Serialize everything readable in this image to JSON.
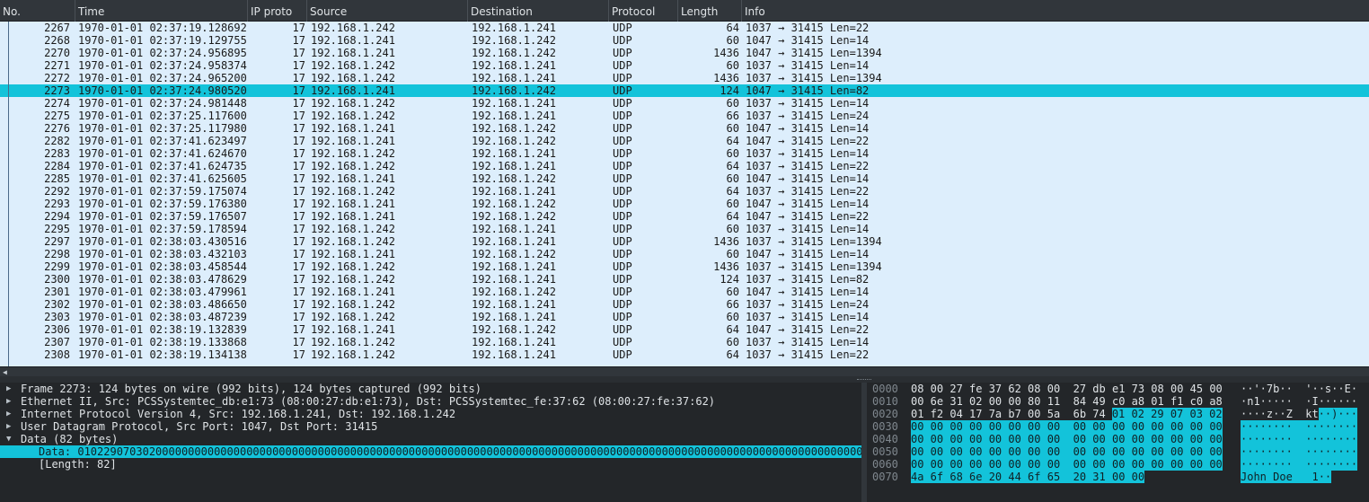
{
  "columns": [
    {
      "key": "no",
      "label": "No."
    },
    {
      "key": "time",
      "label": "Time"
    },
    {
      "key": "ip_proto",
      "label": "IP proto"
    },
    {
      "key": "source",
      "label": "Source"
    },
    {
      "key": "destination",
      "label": "Destination"
    },
    {
      "key": "protocol",
      "label": "Protocol"
    },
    {
      "key": "length",
      "label": "Length"
    },
    {
      "key": "info",
      "label": "Info"
    }
  ],
  "packets": [
    {
      "no": "2267",
      "time": "1970-01-01 02:37:19.128692",
      "ip_proto": "17",
      "source": "192.168.1.242",
      "destination": "192.168.1.241",
      "protocol": "UDP",
      "length": "64",
      "info": "1037 → 31415 Len=22"
    },
    {
      "no": "2268",
      "time": "1970-01-01 02:37:19.129755",
      "ip_proto": "17",
      "source": "192.168.1.241",
      "destination": "192.168.1.242",
      "protocol": "UDP",
      "length": "60",
      "info": "1047 → 31415 Len=14"
    },
    {
      "no": "2270",
      "time": "1970-01-01 02:37:24.956895",
      "ip_proto": "17",
      "source": "192.168.1.241",
      "destination": "192.168.1.242",
      "protocol": "UDP",
      "length": "1436",
      "info": "1047 → 31415 Len=1394"
    },
    {
      "no": "2271",
      "time": "1970-01-01 02:37:24.958374",
      "ip_proto": "17",
      "source": "192.168.1.242",
      "destination": "192.168.1.241",
      "protocol": "UDP",
      "length": "60",
      "info": "1037 → 31415 Len=14"
    },
    {
      "no": "2272",
      "time": "1970-01-01 02:37:24.965200",
      "ip_proto": "17",
      "source": "192.168.1.242",
      "destination": "192.168.1.241",
      "protocol": "UDP",
      "length": "1436",
      "info": "1037 → 31415 Len=1394"
    },
    {
      "no": "2273",
      "time": "1970-01-01 02:37:24.980520",
      "ip_proto": "17",
      "source": "192.168.1.241",
      "destination": "192.168.1.242",
      "protocol": "UDP",
      "length": "124",
      "info": "1047 → 31415 Len=82",
      "selected": true
    },
    {
      "no": "2274",
      "time": "1970-01-01 02:37:24.981448",
      "ip_proto": "17",
      "source": "192.168.1.242",
      "destination": "192.168.1.241",
      "protocol": "UDP",
      "length": "60",
      "info": "1037 → 31415 Len=14"
    },
    {
      "no": "2275",
      "time": "1970-01-01 02:37:25.117600",
      "ip_proto": "17",
      "source": "192.168.1.242",
      "destination": "192.168.1.241",
      "protocol": "UDP",
      "length": "66",
      "info": "1037 → 31415 Len=24"
    },
    {
      "no": "2276",
      "time": "1970-01-01 02:37:25.117980",
      "ip_proto": "17",
      "source": "192.168.1.241",
      "destination": "192.168.1.242",
      "protocol": "UDP",
      "length": "60",
      "info": "1047 → 31415 Len=14"
    },
    {
      "no": "2282",
      "time": "1970-01-01 02:37:41.623497",
      "ip_proto": "17",
      "source": "192.168.1.241",
      "destination": "192.168.1.242",
      "protocol": "UDP",
      "length": "64",
      "info": "1047 → 31415 Len=22"
    },
    {
      "no": "2283",
      "time": "1970-01-01 02:37:41.624670",
      "ip_proto": "17",
      "source": "192.168.1.242",
      "destination": "192.168.1.241",
      "protocol": "UDP",
      "length": "60",
      "info": "1037 → 31415 Len=14"
    },
    {
      "no": "2284",
      "time": "1970-01-01 02:37:41.624735",
      "ip_proto": "17",
      "source": "192.168.1.242",
      "destination": "192.168.1.241",
      "protocol": "UDP",
      "length": "64",
      "info": "1037 → 31415 Len=22"
    },
    {
      "no": "2285",
      "time": "1970-01-01 02:37:41.625605",
      "ip_proto": "17",
      "source": "192.168.1.241",
      "destination": "192.168.1.242",
      "protocol": "UDP",
      "length": "60",
      "info": "1047 → 31415 Len=14"
    },
    {
      "no": "2292",
      "time": "1970-01-01 02:37:59.175074",
      "ip_proto": "17",
      "source": "192.168.1.242",
      "destination": "192.168.1.241",
      "protocol": "UDP",
      "length": "64",
      "info": "1037 → 31415 Len=22"
    },
    {
      "no": "2293",
      "time": "1970-01-01 02:37:59.176380",
      "ip_proto": "17",
      "source": "192.168.1.241",
      "destination": "192.168.1.242",
      "protocol": "UDP",
      "length": "60",
      "info": "1047 → 31415 Len=14"
    },
    {
      "no": "2294",
      "time": "1970-01-01 02:37:59.176507",
      "ip_proto": "17",
      "source": "192.168.1.241",
      "destination": "192.168.1.242",
      "protocol": "UDP",
      "length": "64",
      "info": "1047 → 31415 Len=22"
    },
    {
      "no": "2295",
      "time": "1970-01-01 02:37:59.178594",
      "ip_proto": "17",
      "source": "192.168.1.242",
      "destination": "192.168.1.241",
      "protocol": "UDP",
      "length": "60",
      "info": "1037 → 31415 Len=14"
    },
    {
      "no": "2297",
      "time": "1970-01-01 02:38:03.430516",
      "ip_proto": "17",
      "source": "192.168.1.242",
      "destination": "192.168.1.241",
      "protocol": "UDP",
      "length": "1436",
      "info": "1037 → 31415 Len=1394"
    },
    {
      "no": "2298",
      "time": "1970-01-01 02:38:03.432103",
      "ip_proto": "17",
      "source": "192.168.1.241",
      "destination": "192.168.1.242",
      "protocol": "UDP",
      "length": "60",
      "info": "1047 → 31415 Len=14"
    },
    {
      "no": "2299",
      "time": "1970-01-01 02:38:03.458544",
      "ip_proto": "17",
      "source": "192.168.1.242",
      "destination": "192.168.1.241",
      "protocol": "UDP",
      "length": "1436",
      "info": "1037 → 31415 Len=1394"
    },
    {
      "no": "2300",
      "time": "1970-01-01 02:38:03.478629",
      "ip_proto": "17",
      "source": "192.168.1.242",
      "destination": "192.168.1.241",
      "protocol": "UDP",
      "length": "124",
      "info": "1037 → 31415 Len=82"
    },
    {
      "no": "2301",
      "time": "1970-01-01 02:38:03.479961",
      "ip_proto": "17",
      "source": "192.168.1.241",
      "destination": "192.168.1.242",
      "protocol": "UDP",
      "length": "60",
      "info": "1047 → 31415 Len=14"
    },
    {
      "no": "2302",
      "time": "1970-01-01 02:38:03.486650",
      "ip_proto": "17",
      "source": "192.168.1.242",
      "destination": "192.168.1.241",
      "protocol": "UDP",
      "length": "66",
      "info": "1037 → 31415 Len=24"
    },
    {
      "no": "2303",
      "time": "1970-01-01 02:38:03.487239",
      "ip_proto": "17",
      "source": "192.168.1.242",
      "destination": "192.168.1.241",
      "protocol": "UDP",
      "length": "60",
      "info": "1037 → 31415 Len=14"
    },
    {
      "no": "2306",
      "time": "1970-01-01 02:38:19.132839",
      "ip_proto": "17",
      "source": "192.168.1.241",
      "destination": "192.168.1.242",
      "protocol": "UDP",
      "length": "64",
      "info": "1047 → 31415 Len=22"
    },
    {
      "no": "2307",
      "time": "1970-01-01 02:38:19.133868",
      "ip_proto": "17",
      "source": "192.168.1.242",
      "destination": "192.168.1.241",
      "protocol": "UDP",
      "length": "60",
      "info": "1037 → 31415 Len=14"
    },
    {
      "no": "2308",
      "time": "1970-01-01 02:38:19.134138",
      "ip_proto": "17",
      "source": "192.168.1.242",
      "destination": "192.168.1.241",
      "protocol": "UDP",
      "length": "64",
      "info": "1037 → 31415 Len=22"
    }
  ],
  "details": [
    {
      "expander": "collapsed",
      "text": "Frame 2273: 124 bytes on wire (992 bits), 124 bytes captured (992 bits)"
    },
    {
      "expander": "collapsed",
      "text": "Ethernet II, Src: PCSSystemtec_db:e1:73 (08:00:27:db:e1:73), Dst: PCSSystemtec_fe:37:62 (08:00:27:fe:37:62)"
    },
    {
      "expander": "collapsed",
      "text": "Internet Protocol Version 4, Src: 192.168.1.241, Dst: 192.168.1.242"
    },
    {
      "expander": "collapsed",
      "text": "User Datagram Protocol, Src Port: 1047, Dst Port: 31415"
    },
    {
      "expander": "expanded",
      "text": "Data (82 bytes)"
    },
    {
      "expander": "none",
      "level": 2,
      "selected": true,
      "text": "Data: 0102290703020000000000000000000000000000000000000000000000000000000000000000000000000000000000000000000000000000000000000000000000000000000000000000000000000000000000"
    },
    {
      "expander": "none",
      "level": 2,
      "text": "[Length: 82]"
    }
  ],
  "bytes": [
    {
      "offset": "0000",
      "hex": [
        {
          "t": "08 00 27 fe 37 62 08 00  27 db e1 73 08 00 45 00"
        }
      ],
      "ascii": [
        {
          "t": "··'·7b··  '··s··E·"
        }
      ]
    },
    {
      "offset": "0010",
      "hex": [
        {
          "t": "00 6e 31 02 00 00 80 11  84 49 c0 a8 01 f1 c0 a8"
        }
      ],
      "ascii": [
        {
          "t": "·n1·····  ·I······"
        }
      ]
    },
    {
      "offset": "0020",
      "hex": [
        {
          "t": "01 f2 04 17 7a b7 00 5a  6b 74 "
        },
        {
          "t": "01 02 29 07 03 02",
          "hl": true
        }
      ],
      "ascii": [
        {
          "t": "····z··Z  kt"
        },
        {
          "t": "··)···",
          "hl": true
        }
      ]
    },
    {
      "offset": "0030",
      "hex": [
        {
          "t": "00 00 00 00 00 00 00 00  00 00 00 00 00 00 00 00",
          "hl": true
        }
      ],
      "ascii": [
        {
          "t": "········  ········",
          "hl": true
        }
      ]
    },
    {
      "offset": "0040",
      "hex": [
        {
          "t": "00 00 00 00 00 00 00 00  00 00 00 00 00 00 00 00",
          "hl": true
        }
      ],
      "ascii": [
        {
          "t": "········  ········",
          "hl": true
        }
      ]
    },
    {
      "offset": "0050",
      "hex": [
        {
          "t": "00 00 00 00 00 00 00 00  00 00 00 00 00 00 00 00",
          "hl": true
        }
      ],
      "ascii": [
        {
          "t": "········  ········",
          "hl": true
        }
      ]
    },
    {
      "offset": "0060",
      "hex": [
        {
          "t": "00 00 00 00 00 00 00 00  00 00 00 00 00 00 00 00",
          "hl": true
        }
      ],
      "ascii": [
        {
          "t": "········  ········",
          "hl": true
        }
      ]
    },
    {
      "offset": "0070",
      "hex": [
        {
          "t": "4a 6f 68 6e 20 44 6f 65  20 31 00 00",
          "hl": true
        }
      ],
      "ascii": [
        {
          "t": "John Doe   1··",
          "hl": true
        }
      ]
    }
  ],
  "colors": {
    "row_bg": "#ddeefc",
    "selected": "#13c3da",
    "pane_bg": "#232629",
    "header_bg": "#31363b"
  }
}
